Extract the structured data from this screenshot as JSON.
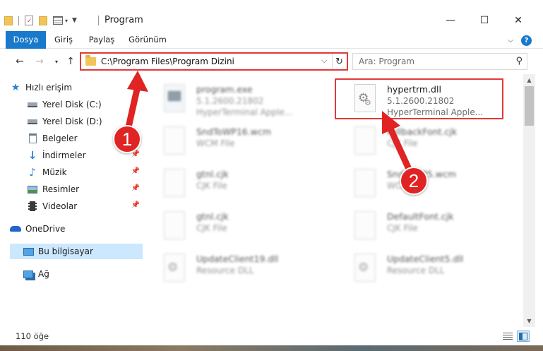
{
  "window": {
    "title": "Program",
    "minimize": "—",
    "maximize": "☐",
    "close": "✕"
  },
  "ribbon": {
    "tabs": [
      "Dosya",
      "Giriş",
      "Paylaş",
      "Görünüm"
    ]
  },
  "address": {
    "path": "C:\\Program Files\\Program Dizini",
    "dropdown": "⌵",
    "refresh": "↻"
  },
  "search": {
    "placeholder": "Ara: Program"
  },
  "sidebar": {
    "items": [
      {
        "label": "Hızlı erişim"
      },
      {
        "label": "Yerel Disk (C:)"
      },
      {
        "label": "Yerel Disk (D:)"
      },
      {
        "label": "Belgeler"
      },
      {
        "label": "İndirmeler"
      },
      {
        "label": "Müzik"
      },
      {
        "label": "Resimler"
      },
      {
        "label": "Videolar"
      },
      {
        "label": "OneDrive"
      },
      {
        "label": "Bu bilgisayar"
      },
      {
        "label": "Ağ"
      }
    ]
  },
  "files": [
    {
      "name": "program.exe",
      "line2": "5.1.2600.21802",
      "line3": "HyperTerminal Apple..."
    },
    {
      "name": "hypertrm.dll",
      "line2": "5.1.2600.21802",
      "line3": "HyperTerminal Apple..."
    },
    {
      "name": "SndToWP16.wcm",
      "line2": "WCM File",
      "line3": ""
    },
    {
      "name": "FallbackFont.cjk",
      "line2": "CJK File",
      "line3": ""
    },
    {
      "name": "gtnl.cjk",
      "line2": "CJK File",
      "line3": ""
    },
    {
      "name": "SndToWP5.wcm",
      "line2": "WCM File",
      "line3": ""
    },
    {
      "name": "gtnl.cjk",
      "line2": "CJK File",
      "line3": ""
    },
    {
      "name": "DefaultFont.cjk",
      "line2": "CJK File",
      "line3": ""
    },
    {
      "name": "UpdateClient19.dll",
      "line2": "Resource DLL",
      "line3": ""
    },
    {
      "name": "UpdateClient5.dll",
      "line2": "Resource DLL",
      "line3": ""
    }
  ],
  "status": {
    "count": "110 öğe"
  },
  "callouts": [
    "1",
    "2"
  ],
  "colors": {
    "accent": "#1979ca",
    "highlight": "#e13a3a",
    "selection": "#cce8ff"
  }
}
